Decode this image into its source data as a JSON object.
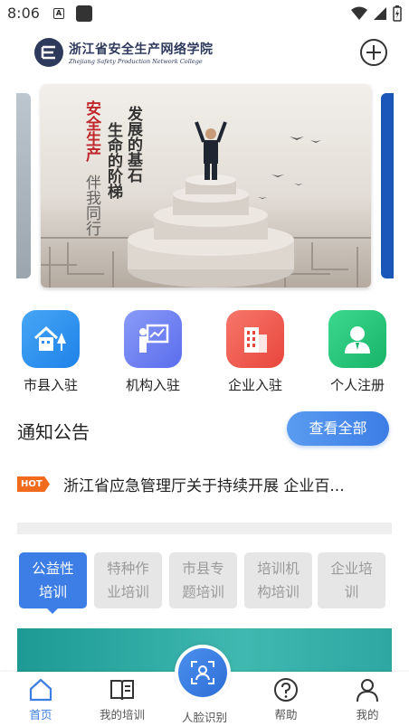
{
  "status_bar": {
    "time": "8:06",
    "a_icon_text": "A"
  },
  "header": {
    "title": "浙江省安全生产网络学院",
    "subtitle": "Zhejiang Safety Production Network College"
  },
  "banner": {
    "line_left": "安全生产",
    "line_left2": "伴我同行",
    "line_mid": "生命的阶梯",
    "line_right": "发展的基石"
  },
  "shortcuts": [
    {
      "label": "市县入驻",
      "icon": "house-icon",
      "color": "#2f8ff0"
    },
    {
      "label": "机构入驻",
      "icon": "presentation-icon",
      "color": "#6a7cf2"
    },
    {
      "label": "企业入驻",
      "icon": "building-icon",
      "color": "#f0574d"
    },
    {
      "label": "个人注册",
      "icon": "person-icon",
      "color": "#22c27a"
    }
  ],
  "notice": {
    "title": "通知公告",
    "view_all": "查看全部",
    "hot": "HOT",
    "item": "浙江省应急管理厅关于持续开展 企业百..."
  },
  "tabs": [
    {
      "label1": "公益性",
      "label2": "培训",
      "active": true
    },
    {
      "label1": "特种作",
      "label2": "业培训",
      "active": false
    },
    {
      "label1": "市县专",
      "label2": "题培训",
      "active": false
    },
    {
      "label1": "培训机",
      "label2": "构培训",
      "active": false
    },
    {
      "label1": "企业培",
      "label2": "训",
      "active": false
    }
  ],
  "bottom_nav": {
    "home": "首页",
    "my_training": "我的培训",
    "face": "人脸识别",
    "help": "帮助",
    "mine": "我的"
  },
  "colors": {
    "accent": "#3c7de6",
    "hot": "#f26a1b",
    "brand": "#2e3a5c"
  }
}
